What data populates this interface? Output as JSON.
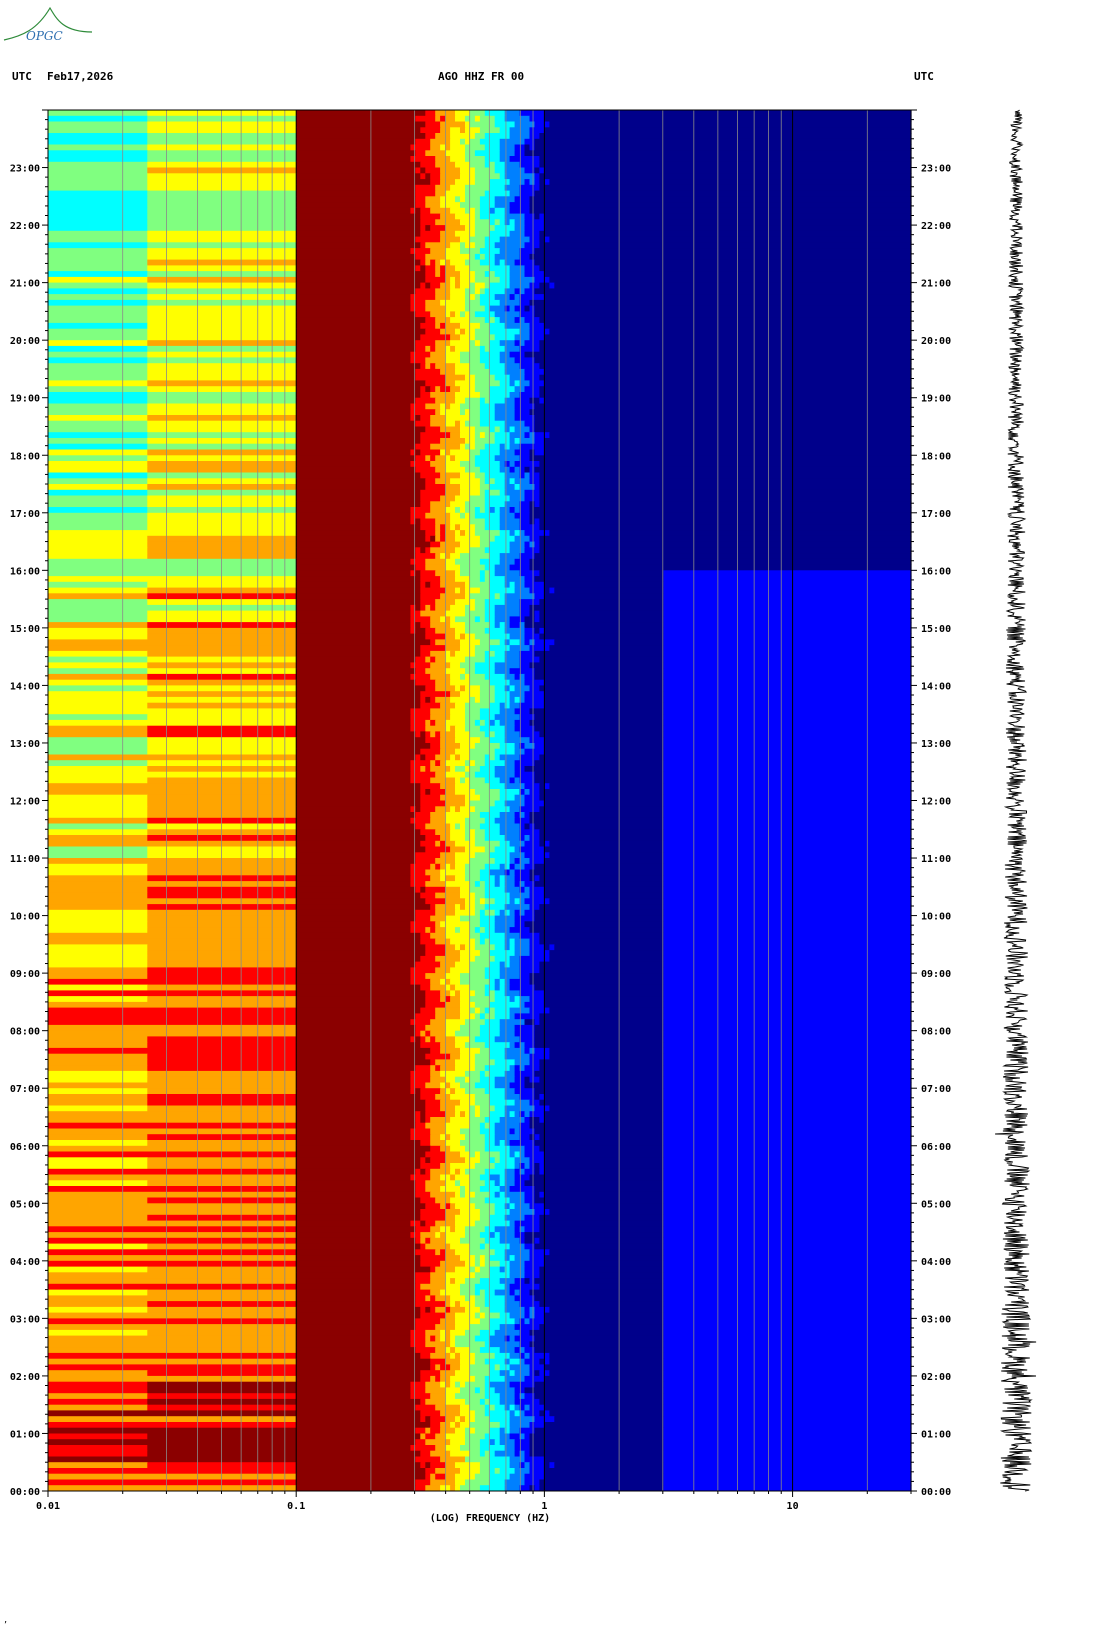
{
  "header": {
    "left_tz": "UTC",
    "date": "Feb17,2026",
    "station": "AGO HHZ FR 00",
    "right_tz": "UTC"
  },
  "logo": {
    "text": "OPGC",
    "color": "#2e8b3a"
  },
  "chart_data": {
    "type": "heatmap",
    "title": "AGO HHZ FR 00",
    "xlabel": "(LOG) FREQUENCY (HZ)",
    "x_scale": "log",
    "xlim": [
      0.01,
      30
    ],
    "x_tick_labels": [
      "0.01",
      "0.1",
      "1",
      "10"
    ],
    "y_tick_labels": [
      "00:00",
      "01:00",
      "02:00",
      "03:00",
      "04:00",
      "05:00",
      "06:00",
      "07:00",
      "08:00",
      "09:00",
      "10:00",
      "11:00",
      "12:00",
      "13:00",
      "14:00",
      "15:00",
      "16:00",
      "17:00",
      "18:00",
      "19:00",
      "20:00",
      "21:00",
      "22:00",
      "23:00"
    ],
    "colormap": [
      "#00008b",
      "#0000ff",
      "#0080ff",
      "#00ffff",
      "#80ff80",
      "#ffff00",
      "#ffa500",
      "#ff0000",
      "#8b0000"
    ],
    "description_bands": [
      {
        "fmin": 0.01,
        "fmax": 0.1,
        "power": "yellow to red, increasing toward 00:00"
      },
      {
        "fmin": 0.1,
        "fmax": 0.28,
        "power": "dark red (max)"
      },
      {
        "fmin": 0.28,
        "fmax": 0.6,
        "power": "red to cyan transition"
      },
      {
        "fmin": 0.6,
        "fmax": 30,
        "power": "blue to dark blue (low)"
      }
    ],
    "seismogram": "vertical trace at right, full day"
  },
  "footer": {
    "mark": "’"
  }
}
